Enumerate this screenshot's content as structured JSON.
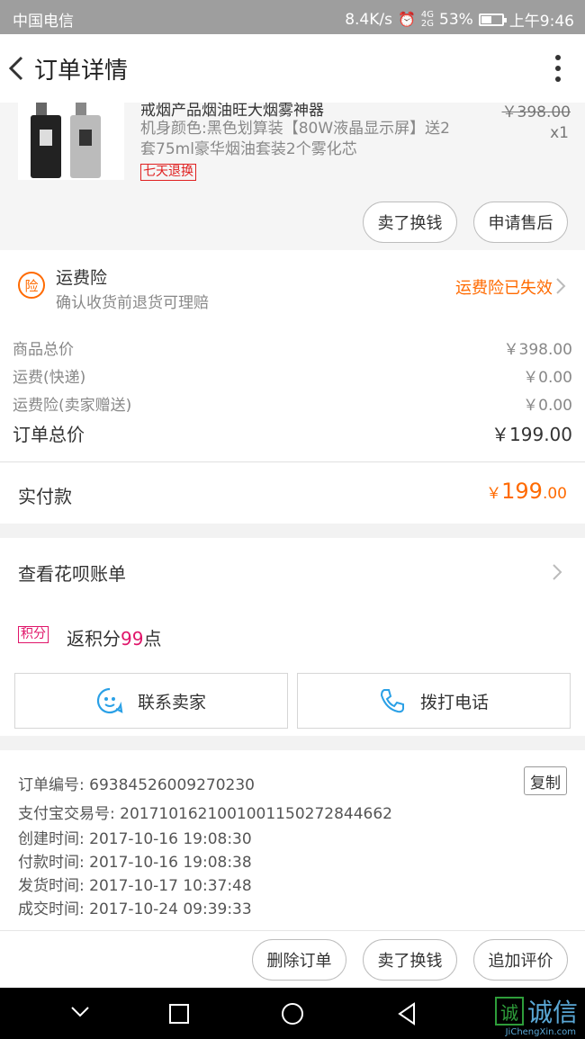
{
  "status_bar": {
    "carrier": "中国电信",
    "net_speed": "8.4K/s",
    "battery": "53%",
    "battery_level": 0.53,
    "time": "上午9:46"
  },
  "header": {
    "title": "订单详情"
  },
  "product": {
    "title": "戒烟产品烟油旺大烟雾神器",
    "spec": "机身颜色:黑色划算装【80W液晶显示屏】送2套75ml豪华烟油套装2个雾化芯",
    "badge": "七天退换",
    "original_price": "￥398.00",
    "quantity": "x1",
    "sell_button": "卖了换钱",
    "after_sale_button": "申请售后"
  },
  "insurance": {
    "icon_char": "险",
    "title": "运费险",
    "subtitle": "确认收货前退货可理赔",
    "status": "运费险已失效"
  },
  "price_summary": {
    "rows": [
      {
        "label": "商品总价",
        "value": "￥398.00"
      },
      {
        "label": "运费(快递)",
        "value": "￥0.00"
      },
      {
        "label": "运费险(卖家赠送)",
        "value": "￥0.00"
      }
    ],
    "total_label": "订单总价",
    "total_value": "￥199.00"
  },
  "paid": {
    "label": "实付款",
    "currency": "￥",
    "amount_int": "199",
    "amount_dec": ".00"
  },
  "huabei": {
    "label": "查看花呗账单"
  },
  "points": {
    "tag": "积分",
    "prefix": "返积分",
    "number": "99",
    "suffix": "点"
  },
  "contact": {
    "seller_label": "联系卖家",
    "phone_label": "拨打电话"
  },
  "order_info": {
    "lines": [
      "订单编号: 69384526009270230",
      "支付宝交易号: 2017101621001001150272844662",
      "创建时间: 2017-10-16 19:08:30",
      "付款时间: 2017-10-16 19:08:38",
      "发货时间: 2017-10-17 10:37:48",
      "成交时间: 2017-10-24 09:39:33"
    ],
    "copy_label": "复制"
  },
  "actions": {
    "delete_label": "删除订单",
    "sell_label": "卖了换钱",
    "review_label": "追加评价"
  },
  "watermark": {
    "icon_char": "诚",
    "text": "诚信",
    "sub": "JiChengXin.com"
  },
  "colors": {
    "accent": "#ff6a00",
    "points": "#e0156a",
    "badge_red": "#e02020",
    "link_blue": "#2aa0e6"
  }
}
